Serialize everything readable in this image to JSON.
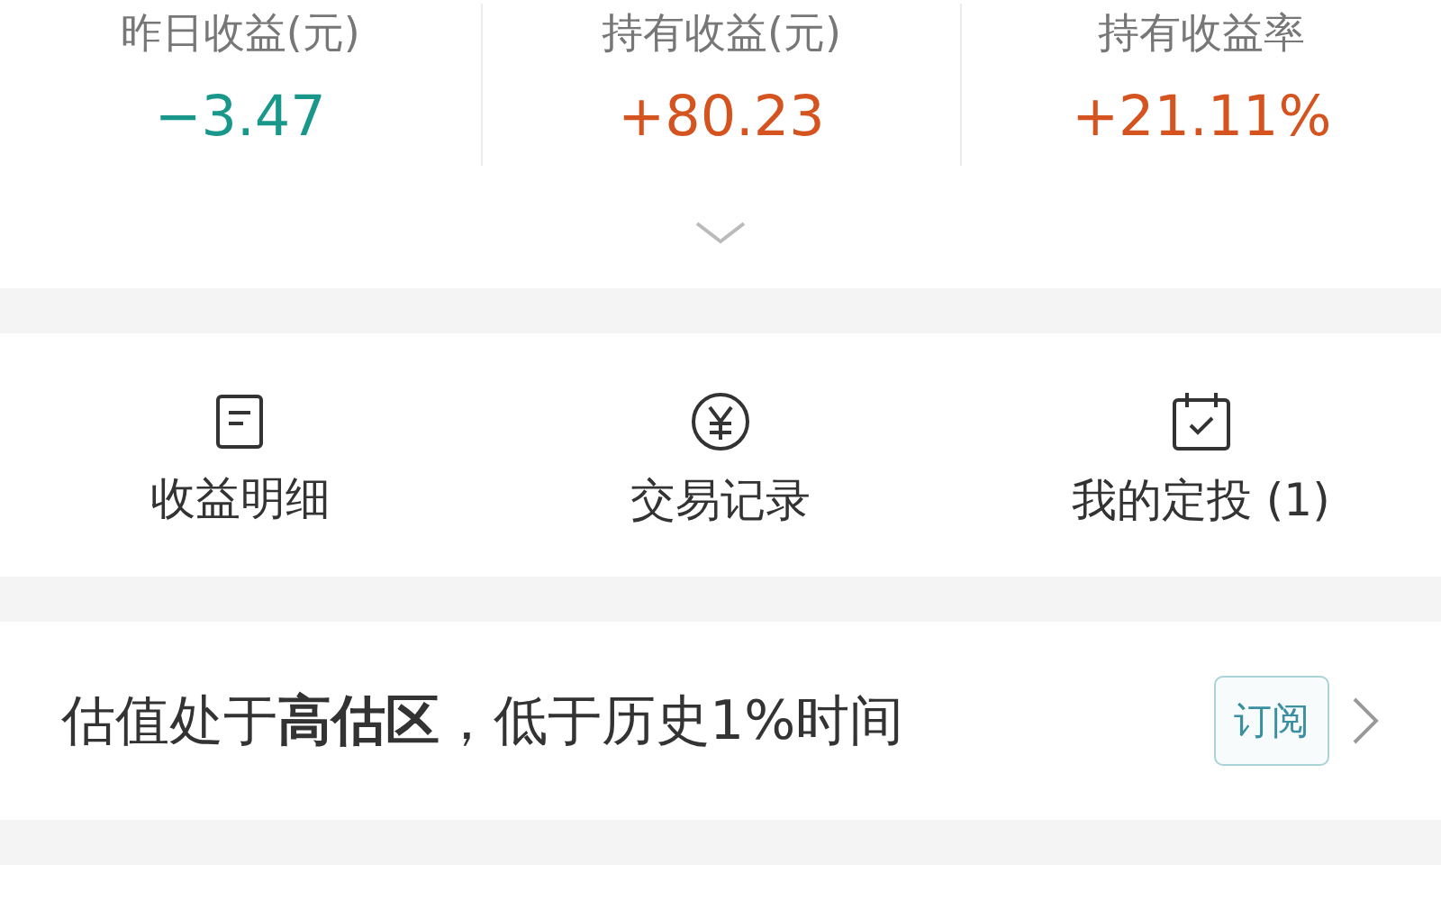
{
  "stats": [
    {
      "label": "昨日收益(元)",
      "value": "−3.47",
      "color": "#19978b"
    },
    {
      "label": "持有收益(元)",
      "value": "+80.23",
      "color": "#d4531f"
    },
    {
      "label": "持有收益率",
      "value": "+21.11%",
      "color": "#d4531f"
    }
  ],
  "actions": [
    {
      "kind": "document",
      "label": "收益明细"
    },
    {
      "kind": "yen",
      "label": "交易记录"
    },
    {
      "kind": "calendar",
      "label": "我的定投 (1)"
    }
  ],
  "valuation": {
    "text": "估值处于**高估区**，低于历史1%时间",
    "button": "订阅"
  }
}
